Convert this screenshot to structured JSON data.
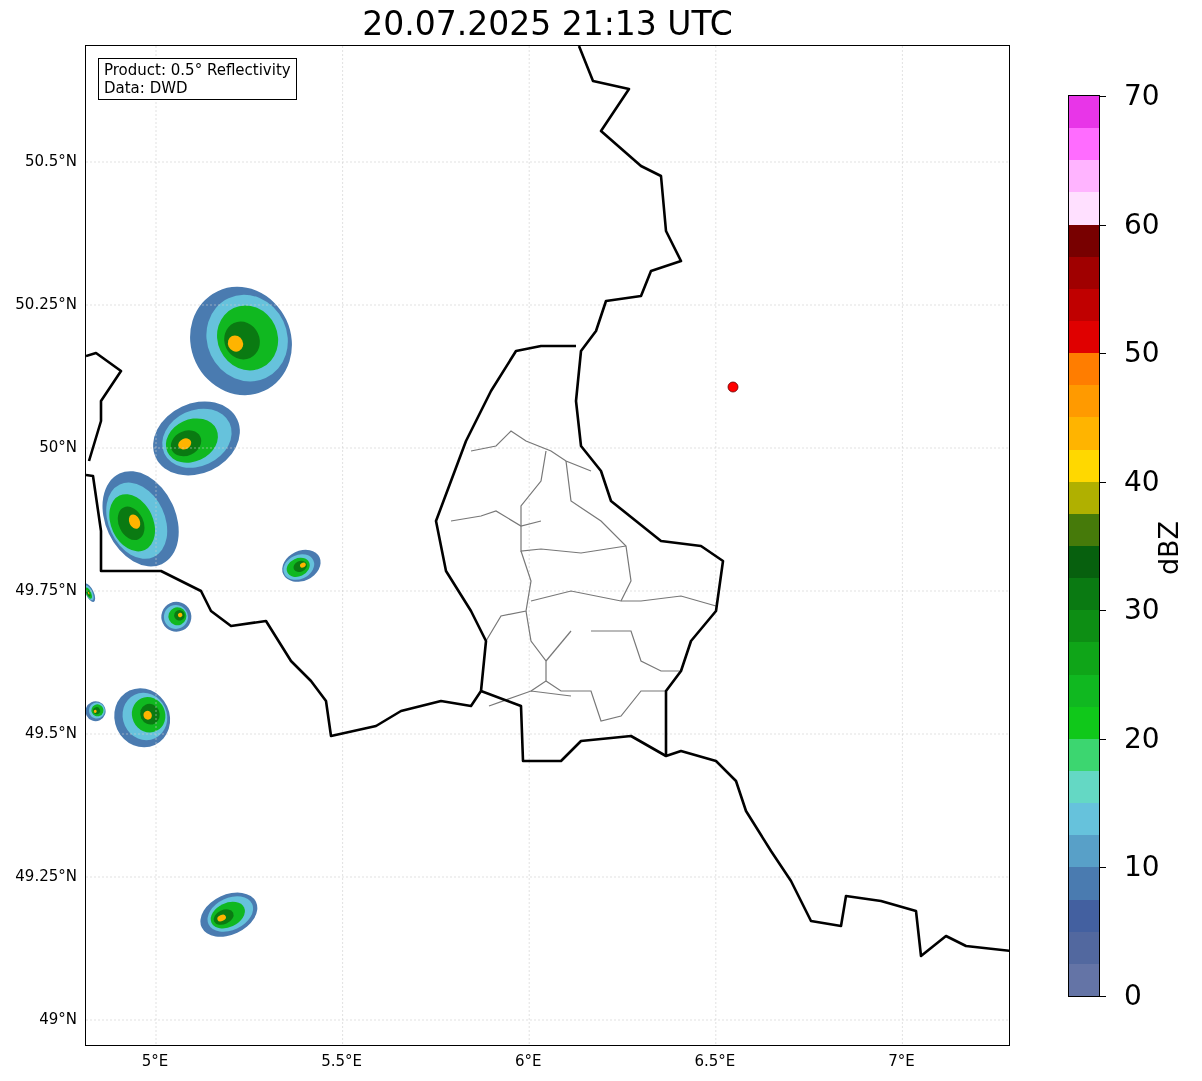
{
  "title": "20.07.2025 21:13 UTC",
  "info_box": {
    "lines": [
      "Product: 0.5° Reflectivity",
      "Data: DWD"
    ]
  },
  "x_ticks": [
    "5°E",
    "5.5°E",
    "6°E",
    "6.5°E",
    "7°E"
  ],
  "y_ticks": [
    "50.5°N",
    "50.25°N",
    "50°N",
    "49.75°N",
    "49.5°N",
    "49.25°N",
    "49°N"
  ],
  "colorbar": {
    "label": "dBZ",
    "ticks": [
      "70",
      "60",
      "50",
      "40",
      "30",
      "20",
      "10",
      "0"
    ],
    "bins": [
      {
        "color": "#6474a6"
      },
      {
        "color": "#52689f"
      },
      {
        "color": "#4360a0"
      },
      {
        "color": "#4a7bb0"
      },
      {
        "color": "#58a0c8"
      },
      {
        "color": "#66c2dc"
      },
      {
        "color": "#64d8c4"
      },
      {
        "color": "#3cd670"
      },
      {
        "color": "#10c81a"
      },
      {
        "color": "#10b820"
      },
      {
        "color": "#0fa518"
      },
      {
        "color": "#0d8e14"
      },
      {
        "color": "#0a7a12"
      },
      {
        "color": "#07600e"
      },
      {
        "color": "#467a0a"
      },
      {
        "color": "#b0b000"
      },
      {
        "color": "#ffd800"
      },
      {
        "color": "#ffb400"
      },
      {
        "color": "#ff9a00"
      },
      {
        "color": "#ff7d00"
      },
      {
        "color": "#e00000"
      },
      {
        "color": "#c00000"
      },
      {
        "color": "#a00000"
      },
      {
        "color": "#780000"
      },
      {
        "color": "#ffe0ff"
      },
      {
        "color": "#ffb4ff"
      },
      {
        "color": "#ff6cff"
      },
      {
        "color": "#e835e8"
      }
    ]
  }
}
